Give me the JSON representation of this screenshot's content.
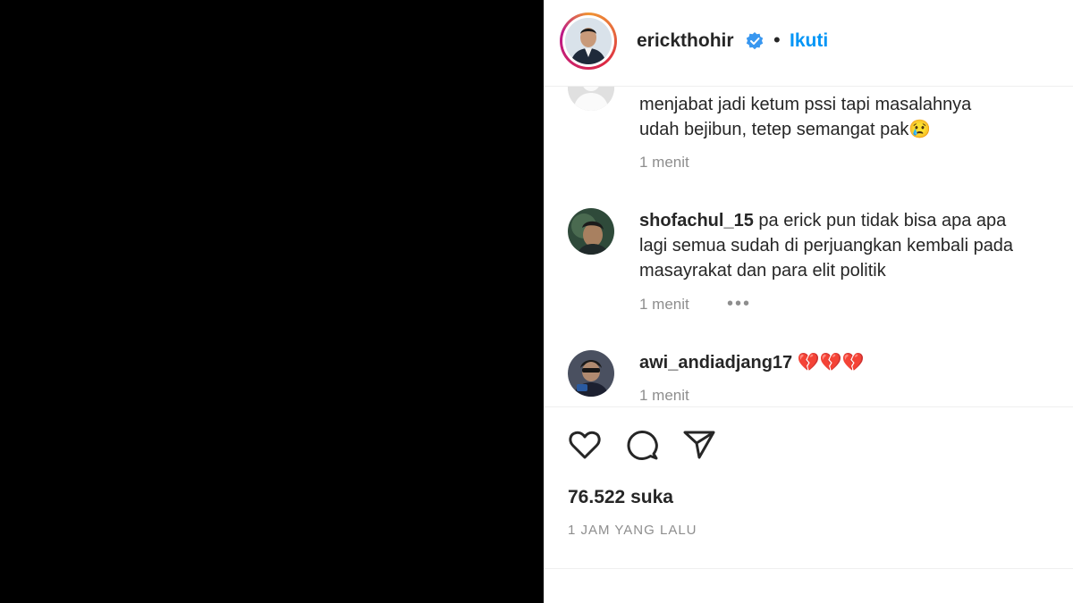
{
  "post": {
    "owner": "erickthohir",
    "follow_label": "Ikuti",
    "dot": "•"
  },
  "comments": [
    {
      "username": "",
      "text_line1": "menjabat jadi ketum pssi tapi masalahnya",
      "text_line2": "udah bejibun, tetep semangat pak😢",
      "time": "1 menit"
    },
    {
      "username": "shofachul_15",
      "text_line1": " pa erick pun tidak bisa apa apa",
      "text_line2": "lagi semua sudah di perjuangkan kembali pada",
      "text_line3": "masayrakat dan para elit politik",
      "time": "1 menit",
      "more": "•••"
    },
    {
      "username": "awi_andiadjang17",
      "text_line1": " 💔💔💔",
      "time": "1 menit"
    }
  ],
  "likes_label": "76.522 suka",
  "time_ago": "1 JAM YANG LALU",
  "icons": {
    "like": "heart-icon",
    "comment": "comment-icon",
    "share": "send-icon",
    "verified": "verified-badge-icon"
  },
  "colors": {
    "accent": "#0095f6",
    "text": "#262626",
    "muted": "#8e8e8e"
  }
}
